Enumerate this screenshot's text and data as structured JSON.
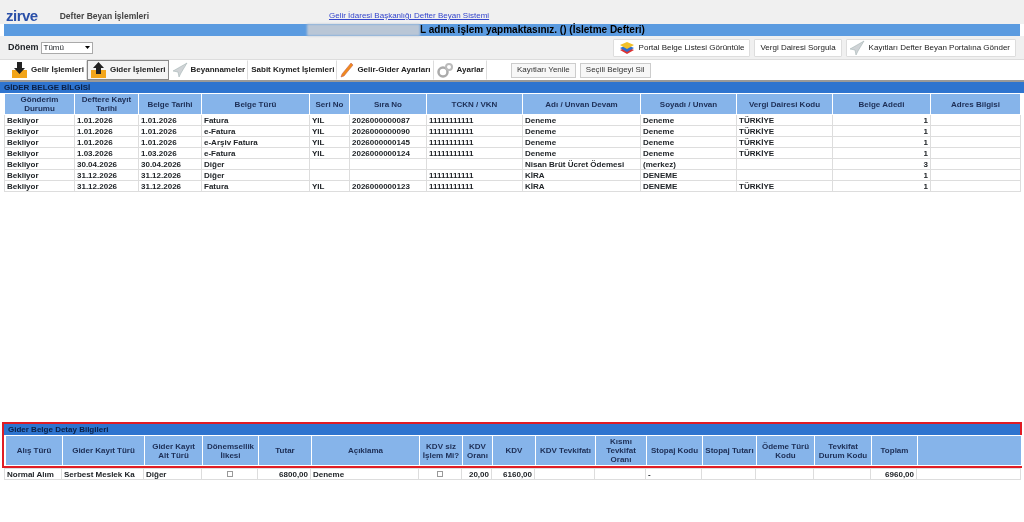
{
  "header": {
    "logo": "zirve",
    "title": "Defter Beyan İşlemleri",
    "link": "Gelir İdaresi Başkanlığı Defter Beyan Sistemi"
  },
  "banner": {
    "text": "L adına işlem yapmaktasınız. () (İsletme Defteri)"
  },
  "period": {
    "label": "Dönem",
    "value": "Tümü"
  },
  "action_buttons": [
    {
      "label": "Portal Belge Listesi Görüntüle",
      "kind": "layers"
    },
    {
      "label": "Vergi Dairesi Sorgula",
      "kind": "plain"
    },
    {
      "label": "Kayıtları Defter Beyan Portalına Gönder",
      "kind": "plane"
    }
  ],
  "tabs": [
    {
      "label": "Gelir İşlemleri",
      "kind": "download",
      "selected": false
    },
    {
      "label": "Gider İşlemleri",
      "kind": "upload",
      "selected": true
    },
    {
      "label": "Beyannameler",
      "kind": "plane",
      "selected": false
    },
    {
      "label": "Sabit Kıymet İşlemleri",
      "kind": "none",
      "selected": false
    },
    {
      "label": "Gelir-Gider Ayarları",
      "kind": "pencil",
      "selected": false
    },
    {
      "label": "Ayarlar",
      "kind": "gears",
      "selected": false
    }
  ],
  "toolbar_buttons": [
    "Kayıtları Yenile",
    "Seçili Belgeyi Sil"
  ],
  "documents": {
    "title": "GİDER BELGE BİLGİSİ",
    "columns": [
      "Gönderim Durumu",
      "Deftere Kayıt Tarihi",
      "Belge Tarihi",
      "Belge Türü",
      "Seri No",
      "Sıra No",
      "TCKN / VKN",
      "Adı / Unvan Devam",
      "Soyadı / Unvan",
      "Vergi Dairesi Kodu",
      "Belge Adedi",
      "Adres Bilgisi"
    ],
    "rows": [
      [
        "Bekliyor",
        "1.01.2026",
        "1.01.2026",
        "Fatura",
        "YIL",
        "2026000000087",
        "11111111111",
        "Deneme",
        "Deneme",
        "TÜRKİYE",
        "1",
        ""
      ],
      [
        "Bekliyor",
        "1.01.2026",
        "1.01.2026",
        "e-Fatura",
        "YIL",
        "2026000000090",
        "11111111111",
        "Deneme",
        "Deneme",
        "TÜRKİYE",
        "1",
        ""
      ],
      [
        "Bekliyor",
        "1.01.2026",
        "1.01.2026",
        "e-Arşiv Fatura",
        "YIL",
        "2026000000145",
        "11111111111",
        "Deneme",
        "Deneme",
        "TÜRKİYE",
        "1",
        ""
      ],
      [
        "Bekliyor",
        "1.03.2026",
        "1.03.2026",
        "e-Fatura",
        "YIL",
        "2026000000124",
        "11111111111",
        "Deneme",
        "Deneme",
        "TÜRKİYE",
        "1",
        ""
      ],
      [
        "Bekliyor",
        "30.04.2026",
        "30.04.2026",
        "Diğer",
        "",
        "",
        "",
        "Nisan Brüt Ücret Ödemesi",
        "(merkez)",
        "",
        "3",
        ""
      ],
      [
        "Bekliyor",
        "31.12.2026",
        "31.12.2026",
        "Diğer",
        "",
        "",
        "11111111111",
        "KİRA",
        "DENEME",
        "",
        "1",
        ""
      ],
      [
        "Bekliyor",
        "31.12.2026",
        "31.12.2026",
        "Fatura",
        "YIL",
        "2026000000123",
        "11111111111",
        "KİRA",
        "DENEME",
        "TÜRKİYE",
        "1",
        ""
      ]
    ]
  },
  "details": {
    "title": "Gider Belge Detay Bilgileri",
    "columns": [
      "Alış Türü",
      "Gider Kayıt Türü",
      "Gider Kayıt Alt Türü",
      "Dönemsellik İlkesi",
      "Tutar",
      "Açıklama",
      "KDV siz İşlem Mi?",
      "KDV Oranı",
      "KDV",
      "KDV Tevkifatı",
      "Kısmı Tevkifat Oranı",
      "Stopaj Kodu",
      "Stopaj Tutarı",
      "Ödeme Türü Kodu",
      "Tevkifat Durum Kodu",
      "Toplam"
    ],
    "rows": [
      {
        "cells": [
          {
            "kind": "text",
            "text": "Normal Alım"
          },
          {
            "kind": "text",
            "text": "Serbest Meslek Ka"
          },
          {
            "kind": "text",
            "text": "Diğer"
          },
          {
            "kind": "checkbox",
            "checked": false
          },
          {
            "kind": "text",
            "text": "6800,00"
          },
          {
            "kind": "text",
            "text": "Deneme"
          },
          {
            "kind": "checkbox",
            "checked": false
          },
          {
            "kind": "text",
            "text": "20,00"
          },
          {
            "kind": "text",
            "text": "6160,00"
          },
          {
            "kind": "text",
            "text": ""
          },
          {
            "kind": "text",
            "text": ""
          },
          {
            "kind": "text",
            "text": "-"
          },
          {
            "kind": "text",
            "text": ""
          },
          {
            "kind": "text",
            "text": ""
          },
          {
            "kind": "text",
            "text": ""
          },
          {
            "kind": "text",
            "text": "6960,00"
          }
        ]
      }
    ]
  }
}
